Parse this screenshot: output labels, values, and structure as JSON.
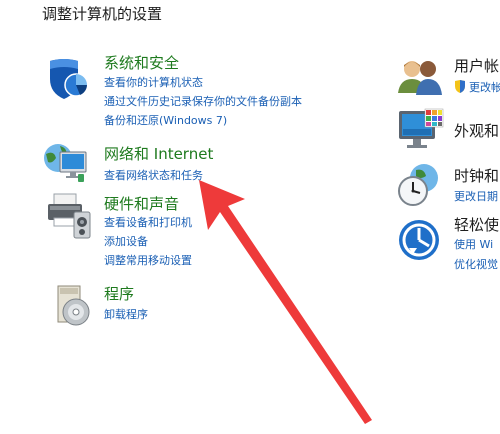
{
  "page": {
    "title": "调整计算机的设置"
  },
  "left_categories": {
    "system_security": {
      "title": "系统和安全",
      "links": [
        "查看你的计算机状态",
        "通过文件历史记录保存你的文件备份副本",
        "备份和还原(Windows 7)"
      ]
    },
    "network_internet": {
      "title": "网络和 Internet",
      "links": [
        "查看网络状态和任务"
      ]
    },
    "hardware_sound": {
      "title": "硬件和声音",
      "links": [
        "查看设备和打印机",
        "添加设备",
        "调整常用移动设置"
      ]
    },
    "programs": {
      "title": "程序",
      "links": [
        "卸载程序"
      ]
    }
  },
  "right_categories": {
    "user_accounts": {
      "title": "用户帐",
      "link": "更改帐"
    },
    "appearance": {
      "title": "外观和"
    },
    "clock_region": {
      "title": "时钟和",
      "link": "更改日期"
    },
    "ease_of_access": {
      "title": "轻松使",
      "links": [
        "使用 Wi",
        "优化视觉"
      ]
    }
  },
  "annotation": {
    "arrow_color": "#ee3a3a"
  }
}
